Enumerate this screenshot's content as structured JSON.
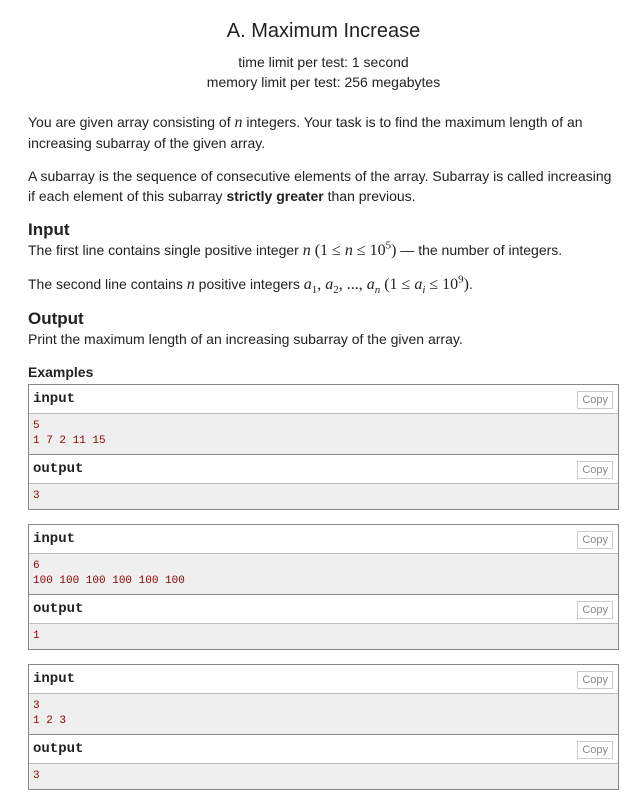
{
  "problem": {
    "title": "A. Maximum Increase",
    "time_limit": "time limit per test: 1 second",
    "memory_limit": "memory limit per test: 256 megabytes",
    "statement": {
      "p1_a": "You are given array consisting of ",
      "p1_var": "n",
      "p1_b": " integers. Your task is to find the maximum length of an increasing subarray of the given array.",
      "p2_a": "A subarray is the sequence of consecutive elements of the array. Subarray is called increasing if each element of this subarray ",
      "p2_bold": "strictly greater",
      "p2_b": " than previous."
    },
    "input_section": {
      "title": "Input",
      "line1_a": "The first line contains single positive integer ",
      "line1_b": " — the number of integers.",
      "line2_a": "The second line contains ",
      "line2_b": " positive integers ",
      "line2_end": "."
    },
    "output_section": {
      "title": "Output",
      "text": "Print the maximum length of an increasing subarray of the given array."
    },
    "examples_title": "Examples",
    "io_labels": {
      "input": "input",
      "output": "output",
      "copy": "Copy"
    },
    "examples": [
      {
        "input": [
          "5",
          "1 7 2 11 15"
        ],
        "output": [
          "3"
        ]
      },
      {
        "input": [
          "6",
          "100 100 100 100 100 100"
        ],
        "output": [
          "1"
        ]
      },
      {
        "input": [
          "3",
          "1 2 3"
        ],
        "output": [
          "3"
        ]
      }
    ]
  }
}
